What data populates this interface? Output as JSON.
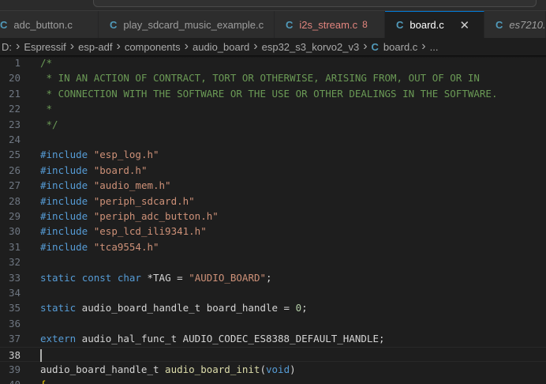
{
  "tabs": [
    {
      "icon": "c-file-icon",
      "glyph": "C",
      "label": "adc_button.c",
      "badge": "",
      "active": false,
      "modified": false,
      "italic": false
    },
    {
      "icon": "c-file-icon",
      "glyph": "C",
      "label": "play_sdcard_music_example.c",
      "badge": "",
      "active": false,
      "modified": false,
      "italic": false
    },
    {
      "icon": "c-file-icon",
      "glyph": "C",
      "label": "i2s_stream.c",
      "badge": "8",
      "active": false,
      "modified": true,
      "italic": false
    },
    {
      "icon": "c-file-icon",
      "glyph": "C",
      "label": "board.c",
      "badge": "",
      "active": true,
      "modified": false,
      "italic": false,
      "close": "✕"
    },
    {
      "icon": "c-file-icon",
      "glyph": "C",
      "label": "es7210.",
      "badge": "",
      "active": false,
      "modified": false,
      "italic": true
    }
  ],
  "breadcrumb": [
    {
      "label": "D:"
    },
    {
      "label": "Espressif"
    },
    {
      "label": "esp-adf"
    },
    {
      "label": "components"
    },
    {
      "label": "audio_board"
    },
    {
      "label": "esp32_s3_korvo2_v3"
    },
    {
      "label": "board.c",
      "glyph": "C"
    },
    {
      "label": "..."
    }
  ],
  "cursor_line": 38,
  "lines": [
    {
      "n": "1",
      "tokens": [
        {
          "t": "comment",
          "v": "/*"
        }
      ]
    },
    {
      "n": "20",
      "tokens": [
        {
          "t": "comment",
          "v": " * IN AN ACTION OF CONTRACT, TORT OR OTHERWISE, ARISING FROM, OUT OF OR IN"
        }
      ]
    },
    {
      "n": "21",
      "tokens": [
        {
          "t": "comment",
          "v": " * CONNECTION WITH THE SOFTWARE OR THE USE OR OTHER DEALINGS IN THE SOFTWARE."
        }
      ]
    },
    {
      "n": "22",
      "tokens": [
        {
          "t": "comment",
          "v": " *"
        }
      ]
    },
    {
      "n": "23",
      "tokens": [
        {
          "t": "comment",
          "v": " */"
        }
      ]
    },
    {
      "n": "24",
      "tokens": []
    },
    {
      "n": "25",
      "tokens": [
        {
          "t": "directive",
          "v": "#include"
        },
        {
          "t": "plain",
          "v": " "
        },
        {
          "t": "string",
          "v": "\"esp_log.h\""
        }
      ]
    },
    {
      "n": "26",
      "tokens": [
        {
          "t": "directive",
          "v": "#include"
        },
        {
          "t": "plain",
          "v": " "
        },
        {
          "t": "string",
          "v": "\"board.h\""
        }
      ]
    },
    {
      "n": "27",
      "tokens": [
        {
          "t": "directive",
          "v": "#include"
        },
        {
          "t": "plain",
          "v": " "
        },
        {
          "t": "string",
          "v": "\"audio_mem.h\""
        }
      ]
    },
    {
      "n": "28",
      "tokens": [
        {
          "t": "directive",
          "v": "#include"
        },
        {
          "t": "plain",
          "v": " "
        },
        {
          "t": "string",
          "v": "\"periph_sdcard.h\""
        }
      ]
    },
    {
      "n": "29",
      "tokens": [
        {
          "t": "directive",
          "v": "#include"
        },
        {
          "t": "plain",
          "v": " "
        },
        {
          "t": "string",
          "v": "\"periph_adc_button.h\""
        }
      ]
    },
    {
      "n": "30",
      "tokens": [
        {
          "t": "directive",
          "v": "#include"
        },
        {
          "t": "plain",
          "v": " "
        },
        {
          "t": "string",
          "v": "\"esp_lcd_ili9341.h\""
        }
      ]
    },
    {
      "n": "31",
      "tokens": [
        {
          "t": "directive",
          "v": "#include"
        },
        {
          "t": "plain",
          "v": " "
        },
        {
          "t": "string",
          "v": "\"tca9554.h\""
        }
      ]
    },
    {
      "n": "32",
      "tokens": []
    },
    {
      "n": "33",
      "tokens": [
        {
          "t": "keyword",
          "v": "static"
        },
        {
          "t": "plain",
          "v": " "
        },
        {
          "t": "keyword",
          "v": "const"
        },
        {
          "t": "plain",
          "v": " "
        },
        {
          "t": "keyword",
          "v": "char"
        },
        {
          "t": "plain",
          "v": " *TAG = "
        },
        {
          "t": "string",
          "v": "\"AUDIO_BOARD\""
        },
        {
          "t": "plain",
          "v": ";"
        }
      ]
    },
    {
      "n": "34",
      "tokens": []
    },
    {
      "n": "35",
      "tokens": [
        {
          "t": "keyword",
          "v": "static"
        },
        {
          "t": "plain",
          "v": " audio_board_handle_t board_handle = "
        },
        {
          "t": "number",
          "v": "0"
        },
        {
          "t": "plain",
          "v": ";"
        }
      ]
    },
    {
      "n": "36",
      "tokens": []
    },
    {
      "n": "37",
      "tokens": [
        {
          "t": "keyword",
          "v": "extern"
        },
        {
          "t": "plain",
          "v": " audio_hal_func_t AUDIO_CODEC_ES8388_DEFAULT_HANDLE;"
        }
      ]
    },
    {
      "n": "38",
      "tokens": []
    },
    {
      "n": "39",
      "tokens": [
        {
          "t": "plain",
          "v": "audio_board_handle_t "
        },
        {
          "t": "func",
          "v": "audio_board_init"
        },
        {
          "t": "plain",
          "v": "("
        },
        {
          "t": "keyword",
          "v": "void"
        },
        {
          "t": "plain",
          "v": ")"
        }
      ]
    },
    {
      "n": "40",
      "tokens": [
        {
          "t": "brace",
          "v": "{"
        }
      ]
    }
  ]
}
